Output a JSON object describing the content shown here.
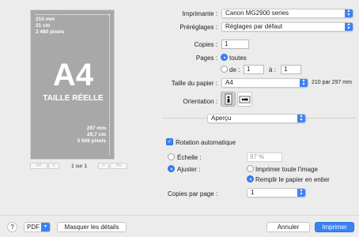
{
  "preview": {
    "top_dims": [
      "210 mm",
      "21 cm",
      "2 480 pixels"
    ],
    "big_text": "A4",
    "sub_text": "TAILLE RÉELLE",
    "bottom_dims": [
      "297 mm",
      "29,7 cm",
      "3 508 pixels"
    ],
    "page_indicator": "1 sur 1"
  },
  "printer": {
    "label": "Imprimante :",
    "value": "Canon MG2900 series"
  },
  "presets": {
    "label": "Préréglages :",
    "value": "Réglages par défaut"
  },
  "copies": {
    "label": "Copies :",
    "value": "1"
  },
  "pages": {
    "label": "Pages :",
    "all_label": "toutes",
    "from_label": "de :",
    "from_value": "1",
    "to_label": "à :",
    "to_value": "1"
  },
  "paper": {
    "label": "Taille du papier :",
    "value": "A4",
    "size_text": "210 par 297 mm"
  },
  "orientation": {
    "label": "Orientation :"
  },
  "section": {
    "value": "Aperçu"
  },
  "auto_rotate": {
    "label": "Rotation automatique"
  },
  "scale": {
    "label": "Échelle :",
    "value": "97 %"
  },
  "fit": {
    "label": "Ajuster :",
    "option_whole": "Imprimer toute l'image",
    "option_fill": "Remplir le papier en entier"
  },
  "copies_per_page": {
    "label": "Copies par page :",
    "value": "1"
  },
  "bottom": {
    "help": "?",
    "pdf": "PDF",
    "hide_details": "Masquer les détails",
    "cancel": "Annuler",
    "print": "Imprimer"
  },
  "colors": {
    "accent": "#3b82f6",
    "preview_gray": "#a8a8a8"
  }
}
